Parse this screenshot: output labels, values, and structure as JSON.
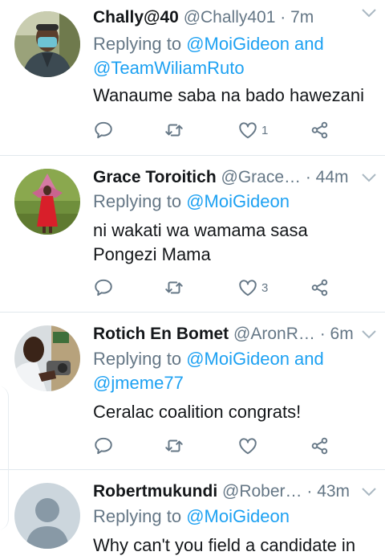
{
  "colors": {
    "link": "#1da1f2",
    "muted": "#657786",
    "text": "#14171a",
    "divider": "#e1e8ed"
  },
  "tweets": [
    {
      "name": "Chally@40",
      "handle": "@Chally401",
      "time": "· 7m",
      "reply_prefix": "Replying to",
      "reply_line1_link": "@MoiGideon and",
      "reply_line2_link": "@TeamWiliamRuto",
      "text_line1": "Wanaume saba na bado hawezani",
      "like_count": "1",
      "avatar_icon": "masked-man-photo"
    },
    {
      "name": "Grace Toroitich",
      "handle": "@Grace…",
      "time": "· 44m",
      "reply_prefix": "Replying to",
      "reply_line1_link": "@MoiGideon",
      "text_line1": "ni wakati wa wamama sasa",
      "text_line2": "Pongezi Mama",
      "like_count": "3",
      "avatar_icon": "woman-red-dress-photo"
    },
    {
      "name": "Rotich En Bomet",
      "handle": "@AronR…",
      "time": "· 6m",
      "reply_prefix": "Replying to",
      "reply_line1_link": "@MoiGideon and",
      "reply_line2_link": "@jmeme77",
      "text_line1": "Ceralac coalition congrats!",
      "like_count": "",
      "avatar_icon": "man-white-shirt-photo"
    },
    {
      "name": "Robertmukundi",
      "handle": "@Rober…",
      "time": "· 43m",
      "reply_prefix": "Replying to",
      "reply_line1_link": "@MoiGideon",
      "text_line1": "Why can't you field a candidate in",
      "avatar_icon": "default-profile-icon"
    }
  ]
}
